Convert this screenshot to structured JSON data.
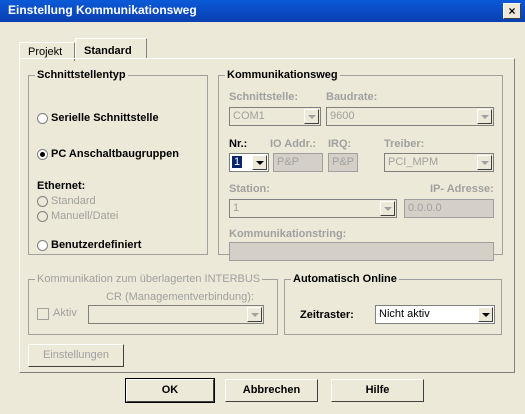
{
  "window": {
    "title": "Einstellung Kommunikationsweg",
    "close": "×"
  },
  "tabs": [
    "Projekt",
    "Standard"
  ],
  "schnittstellentyp": {
    "legend": "Schnittstellentyp",
    "seriell": "Serielle Schnittstelle",
    "pc": "PC Anschaltbaugruppen",
    "ethernet": "Ethernet:",
    "standard": "Standard",
    "manuell": "Manuell/Datei",
    "benutzer": "Benutzerdefiniert"
  },
  "komweg": {
    "legend": "Kommunikationsweg",
    "schnittstelle_label": "Schnittstelle:",
    "schnittstelle_value": "COM1",
    "baudrate_label": "Baudrate:",
    "baudrate_value": "9600",
    "nr_label": "Nr.:",
    "nr_value": "1",
    "io_label": "IO Addr.:",
    "io_value": "P&P",
    "irq_label": "IRQ:",
    "irq_value": "P&P",
    "treiber_label": "Treiber:",
    "treiber_value": "PCI_MPM",
    "station_label": "Station:",
    "station_value": "1",
    "ip_label": "IP- Adresse:",
    "ip_value": "0.0.0.0",
    "kstring_label": "Kommunikationstring:"
  },
  "interbus": {
    "legend": "Kommunikation zum überlagerten INTERBUS",
    "cr_label": "CR (Managementverbindung):",
    "aktiv": "Aktiv"
  },
  "online": {
    "legend": "Automatisch Online",
    "zeitraster_label": "Zeitraster:",
    "zeitraster_value": "Nicht aktiv"
  },
  "buttons": {
    "einstellungen": "Einstellungen",
    "ok": "OK",
    "abbrechen": "Abbrechen",
    "hilfe": "Hilfe"
  }
}
